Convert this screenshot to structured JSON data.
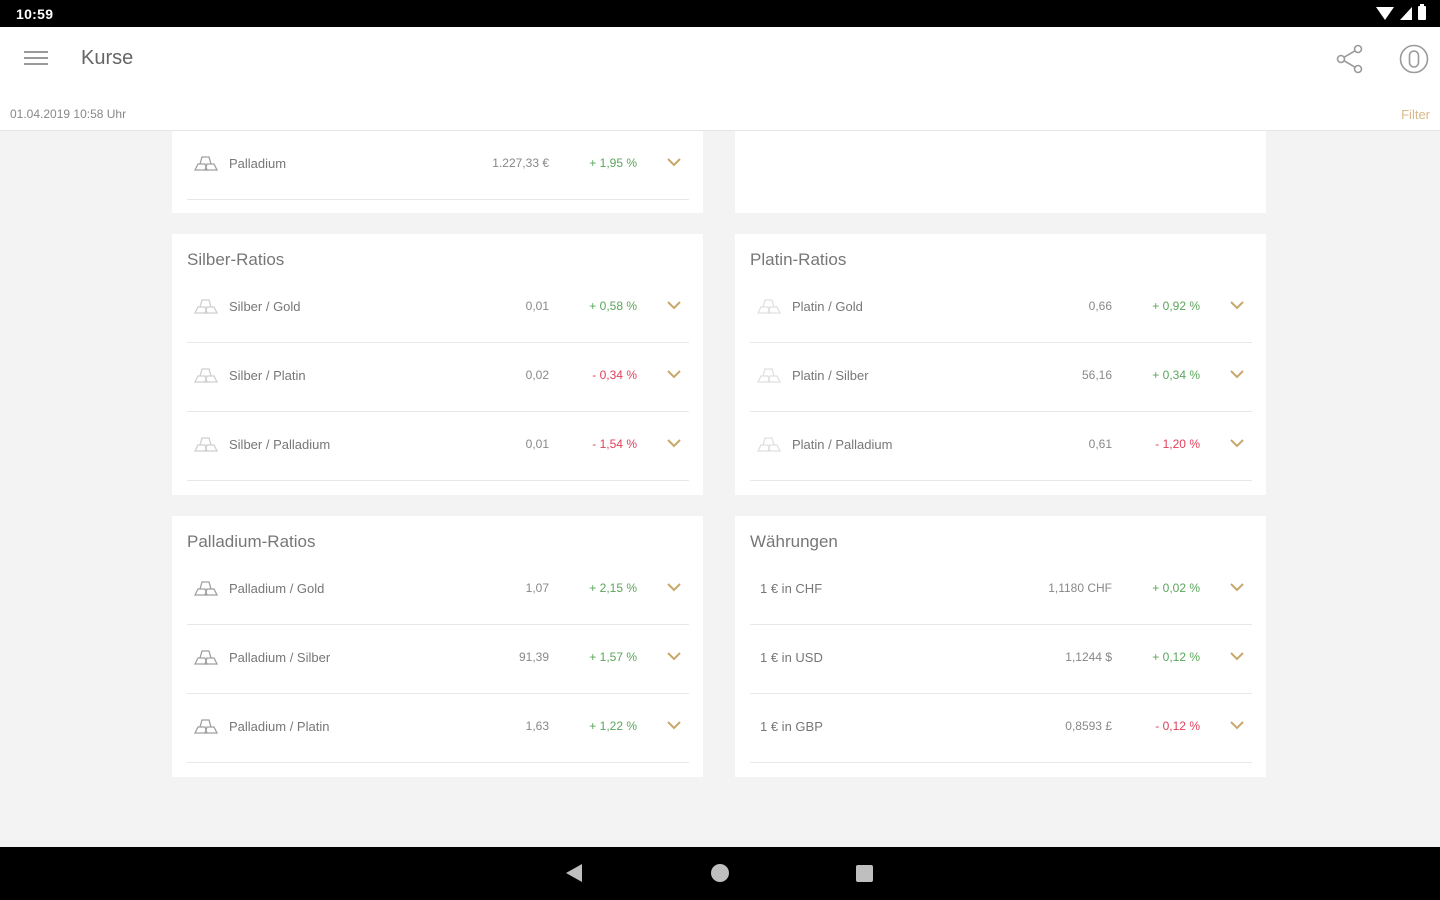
{
  "status_bar": {
    "time": "10:59"
  },
  "app_bar": {
    "title": "Kurse",
    "timestamp": "01.04.2019 10:58 Uhr",
    "filter_label": "Filter"
  },
  "colors": {
    "accent": "#d9b98a",
    "positive": "#5aa65a",
    "negative": "#e0405a"
  },
  "cards": {
    "palladium_top": {
      "rows": [
        {
          "name": "Palladium",
          "value": "1.227,33 €",
          "change": "+ 1,95 %",
          "trend": "up"
        }
      ]
    },
    "silber_ratios": {
      "title": "Silber-Ratios",
      "rows": [
        {
          "name": "Silber / Gold",
          "value": "0,01",
          "change": "+ 0,58 %",
          "trend": "up"
        },
        {
          "name": "Silber / Platin",
          "value": "0,02",
          "change": "- 0,34 %",
          "trend": "down"
        },
        {
          "name": "Silber / Palladium",
          "value": "0,01",
          "change": "- 1,54 %",
          "trend": "down"
        }
      ]
    },
    "platin_ratios": {
      "title": "Platin-Ratios",
      "rows": [
        {
          "name": "Platin / Gold",
          "value": "0,66",
          "change": "+ 0,92 %",
          "trend": "up"
        },
        {
          "name": "Platin / Silber",
          "value": "56,16",
          "change": "+ 0,34 %",
          "trend": "up"
        },
        {
          "name": "Platin / Palladium",
          "value": "0,61",
          "change": "- 1,20 %",
          "trend": "down"
        }
      ]
    },
    "palladium_ratios": {
      "title": "Palladium-Ratios",
      "rows": [
        {
          "name": "Palladium / Gold",
          "value": "1,07",
          "change": "+ 2,15 %",
          "trend": "up"
        },
        {
          "name": "Palladium / Silber",
          "value": "91,39",
          "change": "+ 1,57 %",
          "trend": "up"
        },
        {
          "name": "Palladium / Platin",
          "value": "1,63",
          "change": "+ 1,22 %",
          "trend": "up"
        }
      ]
    },
    "waehrungen": {
      "title": "Währungen",
      "rows": [
        {
          "name": "1 € in CHF",
          "value": "1,1180 CHF",
          "change": "+ 0,02 %",
          "trend": "up"
        },
        {
          "name": "1 € in USD",
          "value": "1,1244 $",
          "change": "+ 0,12 %",
          "trend": "up"
        },
        {
          "name": "1 € in GBP",
          "value": "0,8593 £",
          "change": "- 0,12 %",
          "trend": "down"
        }
      ]
    }
  }
}
